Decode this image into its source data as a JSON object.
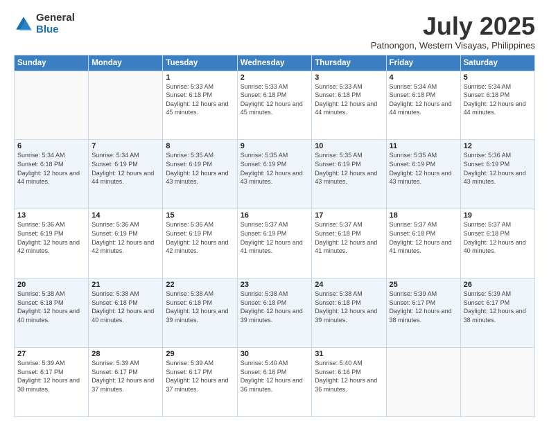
{
  "logo": {
    "general": "General",
    "blue": "Blue"
  },
  "title": "July 2025",
  "subtitle": "Patnongon, Western Visayas, Philippines",
  "days_of_week": [
    "Sunday",
    "Monday",
    "Tuesday",
    "Wednesday",
    "Thursday",
    "Friday",
    "Saturday"
  ],
  "weeks": [
    [
      {
        "day": "",
        "info": ""
      },
      {
        "day": "",
        "info": ""
      },
      {
        "day": "1",
        "info": "Sunrise: 5:33 AM\nSunset: 6:18 PM\nDaylight: 12 hours and 45 minutes."
      },
      {
        "day": "2",
        "info": "Sunrise: 5:33 AM\nSunset: 6:18 PM\nDaylight: 12 hours and 45 minutes."
      },
      {
        "day": "3",
        "info": "Sunrise: 5:33 AM\nSunset: 6:18 PM\nDaylight: 12 hours and 44 minutes."
      },
      {
        "day": "4",
        "info": "Sunrise: 5:34 AM\nSunset: 6:18 PM\nDaylight: 12 hours and 44 minutes."
      },
      {
        "day": "5",
        "info": "Sunrise: 5:34 AM\nSunset: 6:18 PM\nDaylight: 12 hours and 44 minutes."
      }
    ],
    [
      {
        "day": "6",
        "info": "Sunrise: 5:34 AM\nSunset: 6:18 PM\nDaylight: 12 hours and 44 minutes."
      },
      {
        "day": "7",
        "info": "Sunrise: 5:34 AM\nSunset: 6:19 PM\nDaylight: 12 hours and 44 minutes."
      },
      {
        "day": "8",
        "info": "Sunrise: 5:35 AM\nSunset: 6:19 PM\nDaylight: 12 hours and 43 minutes."
      },
      {
        "day": "9",
        "info": "Sunrise: 5:35 AM\nSunset: 6:19 PM\nDaylight: 12 hours and 43 minutes."
      },
      {
        "day": "10",
        "info": "Sunrise: 5:35 AM\nSunset: 6:19 PM\nDaylight: 12 hours and 43 minutes."
      },
      {
        "day": "11",
        "info": "Sunrise: 5:35 AM\nSunset: 6:19 PM\nDaylight: 12 hours and 43 minutes."
      },
      {
        "day": "12",
        "info": "Sunrise: 5:36 AM\nSunset: 6:19 PM\nDaylight: 12 hours and 43 minutes."
      }
    ],
    [
      {
        "day": "13",
        "info": "Sunrise: 5:36 AM\nSunset: 6:19 PM\nDaylight: 12 hours and 42 minutes."
      },
      {
        "day": "14",
        "info": "Sunrise: 5:36 AM\nSunset: 6:19 PM\nDaylight: 12 hours and 42 minutes."
      },
      {
        "day": "15",
        "info": "Sunrise: 5:36 AM\nSunset: 6:19 PM\nDaylight: 12 hours and 42 minutes."
      },
      {
        "day": "16",
        "info": "Sunrise: 5:37 AM\nSunset: 6:19 PM\nDaylight: 12 hours and 41 minutes."
      },
      {
        "day": "17",
        "info": "Sunrise: 5:37 AM\nSunset: 6:18 PM\nDaylight: 12 hours and 41 minutes."
      },
      {
        "day": "18",
        "info": "Sunrise: 5:37 AM\nSunset: 6:18 PM\nDaylight: 12 hours and 41 minutes."
      },
      {
        "day": "19",
        "info": "Sunrise: 5:37 AM\nSunset: 6:18 PM\nDaylight: 12 hours and 40 minutes."
      }
    ],
    [
      {
        "day": "20",
        "info": "Sunrise: 5:38 AM\nSunset: 6:18 PM\nDaylight: 12 hours and 40 minutes."
      },
      {
        "day": "21",
        "info": "Sunrise: 5:38 AM\nSunset: 6:18 PM\nDaylight: 12 hours and 40 minutes."
      },
      {
        "day": "22",
        "info": "Sunrise: 5:38 AM\nSunset: 6:18 PM\nDaylight: 12 hours and 39 minutes."
      },
      {
        "day": "23",
        "info": "Sunrise: 5:38 AM\nSunset: 6:18 PM\nDaylight: 12 hours and 39 minutes."
      },
      {
        "day": "24",
        "info": "Sunrise: 5:38 AM\nSunset: 6:18 PM\nDaylight: 12 hours and 39 minutes."
      },
      {
        "day": "25",
        "info": "Sunrise: 5:39 AM\nSunset: 6:17 PM\nDaylight: 12 hours and 38 minutes."
      },
      {
        "day": "26",
        "info": "Sunrise: 5:39 AM\nSunset: 6:17 PM\nDaylight: 12 hours and 38 minutes."
      }
    ],
    [
      {
        "day": "27",
        "info": "Sunrise: 5:39 AM\nSunset: 6:17 PM\nDaylight: 12 hours and 38 minutes."
      },
      {
        "day": "28",
        "info": "Sunrise: 5:39 AM\nSunset: 6:17 PM\nDaylight: 12 hours and 37 minutes."
      },
      {
        "day": "29",
        "info": "Sunrise: 5:39 AM\nSunset: 6:17 PM\nDaylight: 12 hours and 37 minutes."
      },
      {
        "day": "30",
        "info": "Sunrise: 5:40 AM\nSunset: 6:16 PM\nDaylight: 12 hours and 36 minutes."
      },
      {
        "day": "31",
        "info": "Sunrise: 5:40 AM\nSunset: 6:16 PM\nDaylight: 12 hours and 36 minutes."
      },
      {
        "day": "",
        "info": ""
      },
      {
        "day": "",
        "info": ""
      }
    ]
  ]
}
